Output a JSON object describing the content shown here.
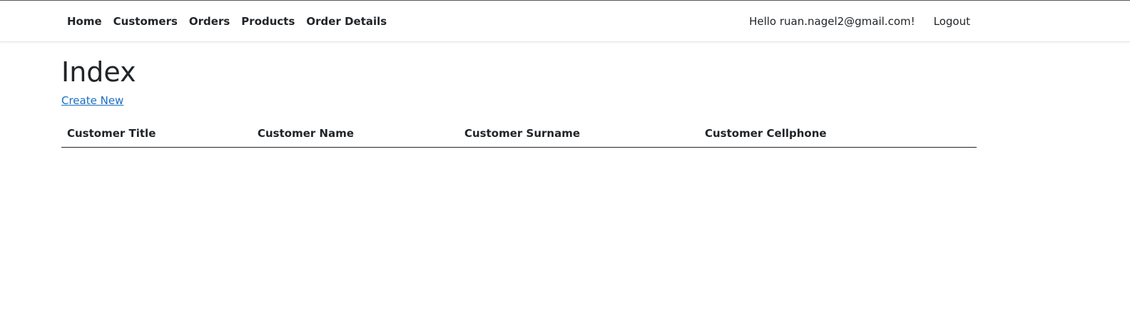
{
  "nav": {
    "links": [
      "Home",
      "Customers",
      "Orders",
      "Products",
      "Order Details"
    ],
    "greeting": "Hello ruan.nagel2@gmail.com!",
    "logout_label": "Logout"
  },
  "main": {
    "title": "Index",
    "create_link": "Create New",
    "table": {
      "headers": [
        "Customer Title",
        "Customer Name",
        "Customer Surname",
        "Customer Cellphone"
      ],
      "rows": []
    }
  },
  "colors": {
    "link": "#1b6ec2",
    "text": "#212529"
  }
}
